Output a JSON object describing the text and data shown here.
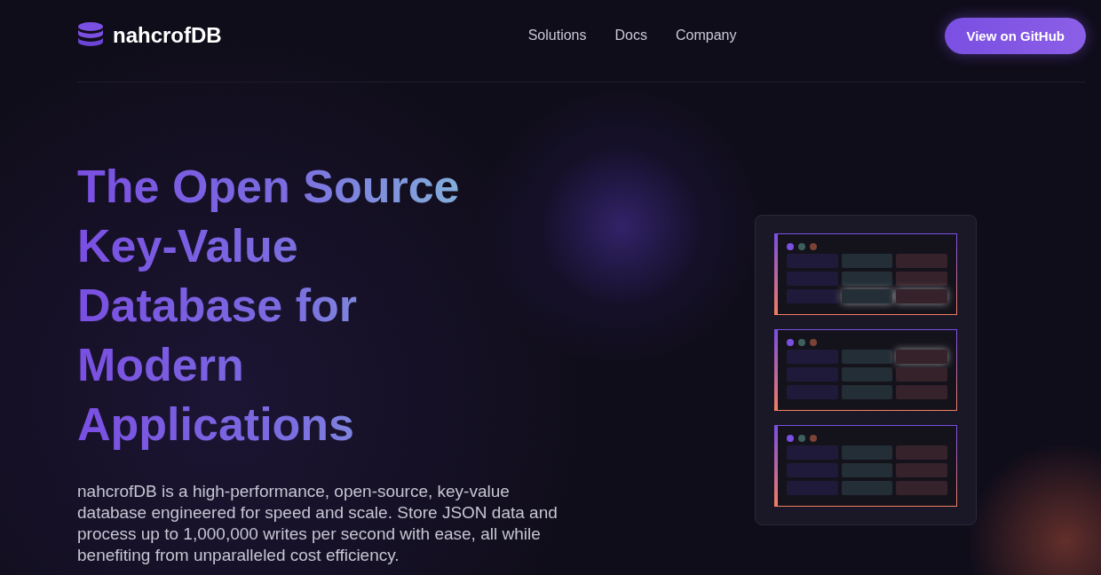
{
  "brand": {
    "name": "nahcrofDB"
  },
  "nav": {
    "links": [
      "Solutions",
      "Docs",
      "Company"
    ],
    "cta": "View on GitHub"
  },
  "hero": {
    "title": "The Open Source Key-Value Database for Modern Applications",
    "description": "nahcrofDB is a high-performance, open-source, key-value database engineered for speed and scale. Store JSON data and process up to 1,000,000 writes per second with ease, all while benefiting from unparalleled cost efficiency."
  }
}
